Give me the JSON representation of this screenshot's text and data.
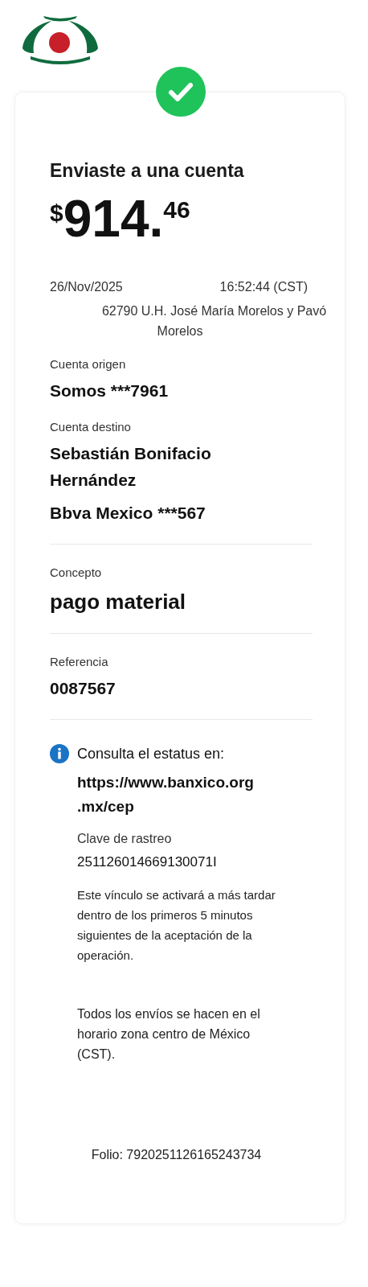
{
  "receipt": {
    "title": "Enviaste a una cuenta",
    "amount": {
      "currency": "$",
      "integer": "914.",
      "cents": "46"
    },
    "date": "26/Nov/2025",
    "time": "16:52:44 (CST)",
    "address_lines": [
      "62790 U.H. José María Morelos y Pavó",
      "Morelos"
    ],
    "sections": [
      {
        "label": "Cuenta origen",
        "values": [
          "Somos ***7961"
        ],
        "kind": "normal",
        "divider": false
      },
      {
        "label": "Cuenta destino",
        "values": [
          "Sebastián Bonifacio Hernández",
          "Bbva Mexico ***567"
        ],
        "kind": "normal",
        "divider": true
      },
      {
        "label": "Concepto",
        "values": [
          "pago material"
        ],
        "kind": "large",
        "divider": true
      },
      {
        "label": "Referencia",
        "values": [
          "0087567"
        ],
        "kind": "normal",
        "divider": true
      }
    ],
    "info": {
      "text": "Consulta el estatus en:",
      "link_lines": [
        "https://www.banxico.org",
        ".mx/cep"
      ],
      "tracking_label": "Clave de rastreo",
      "tracking_value": "251126014669130071I",
      "note": "Este vínculo se activará a más tardar dentro de los primeros 5 minutos siguientes de la aceptación de la operación.",
      "footnote": "Todos los envíos se hacen en el horario zona centro de México (CST)."
    },
    "folio": "Folio: 7920251126165243734"
  }
}
